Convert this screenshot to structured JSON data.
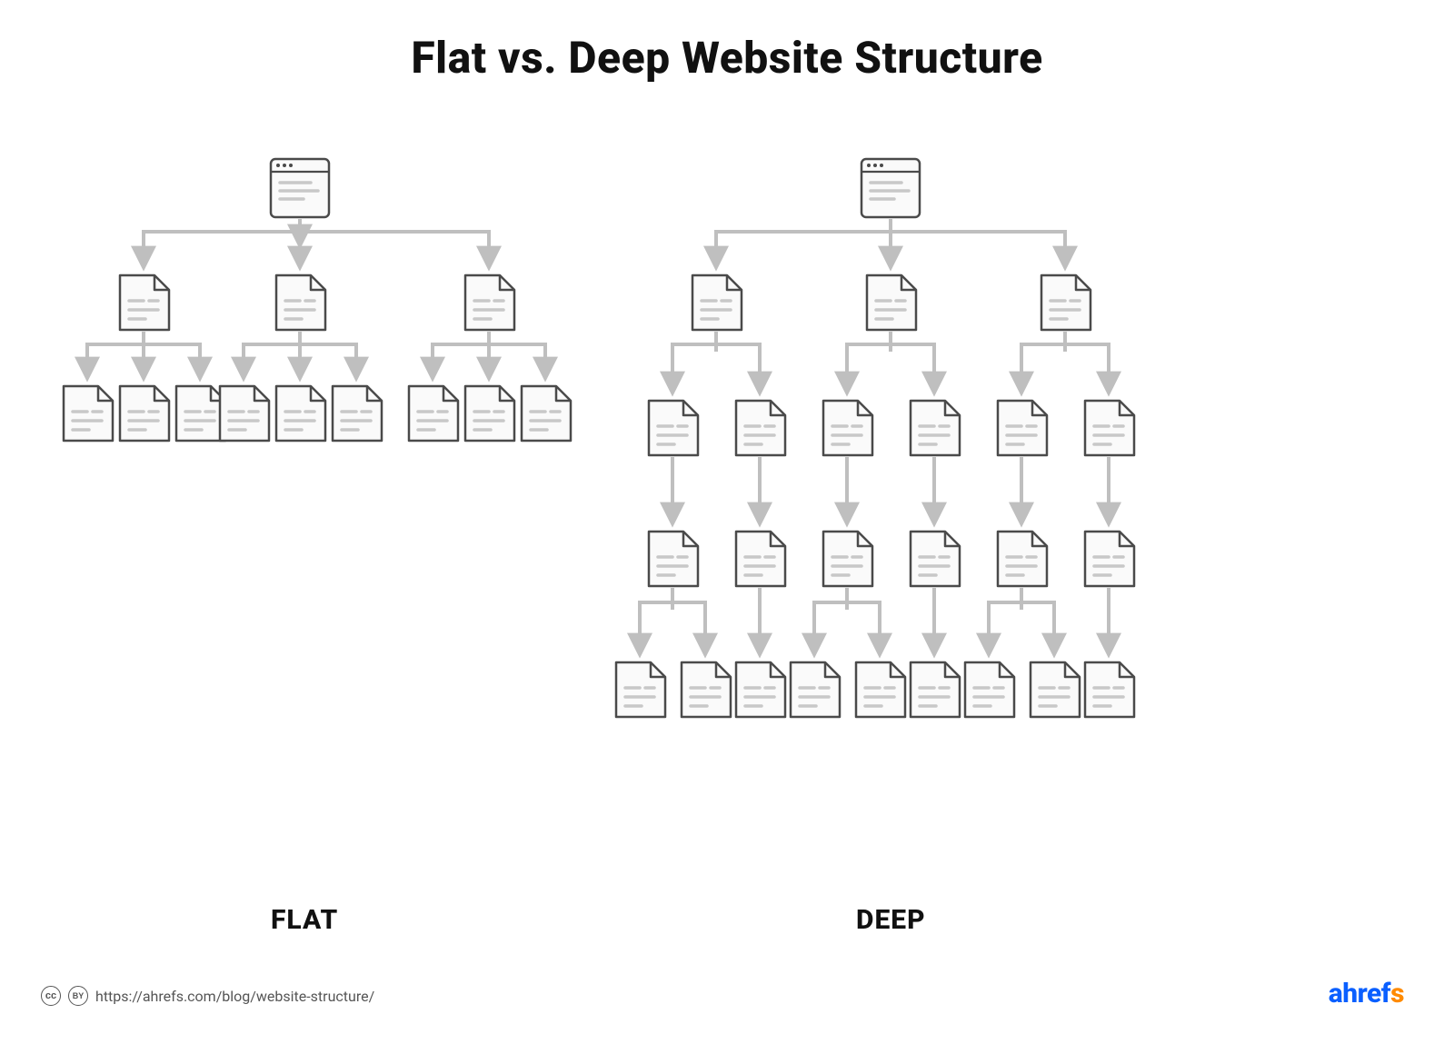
{
  "title": "Flat vs. Deep Website Structure",
  "labels": {
    "flat": "FLAT",
    "deep": "DEEP"
  },
  "footer": {
    "cc_text": "cc",
    "by_text": "BY",
    "url": "https://ahrefs.com/blog/website-structure/"
  },
  "brand": {
    "part1": "ahref",
    "part2": "s"
  },
  "colors": {
    "stroke": "#4a4a4a",
    "fill": "#fafafa",
    "line": "#e4e4e4",
    "connector": "#bfbfbf"
  },
  "structures": {
    "flat": {
      "root": "browser",
      "levels": [
        {
          "count": 3,
          "type": "page"
        },
        {
          "count_per_parent": 3,
          "type": "page"
        }
      ]
    },
    "deep": {
      "root": "browser",
      "levels": [
        {
          "count": 3,
          "type": "page"
        },
        {
          "count_per_parent": 2,
          "type": "page"
        },
        {
          "count_per_parent": 1,
          "type": "page"
        },
        {
          "count_per_chain": "1-or-2",
          "type": "page"
        }
      ]
    }
  }
}
